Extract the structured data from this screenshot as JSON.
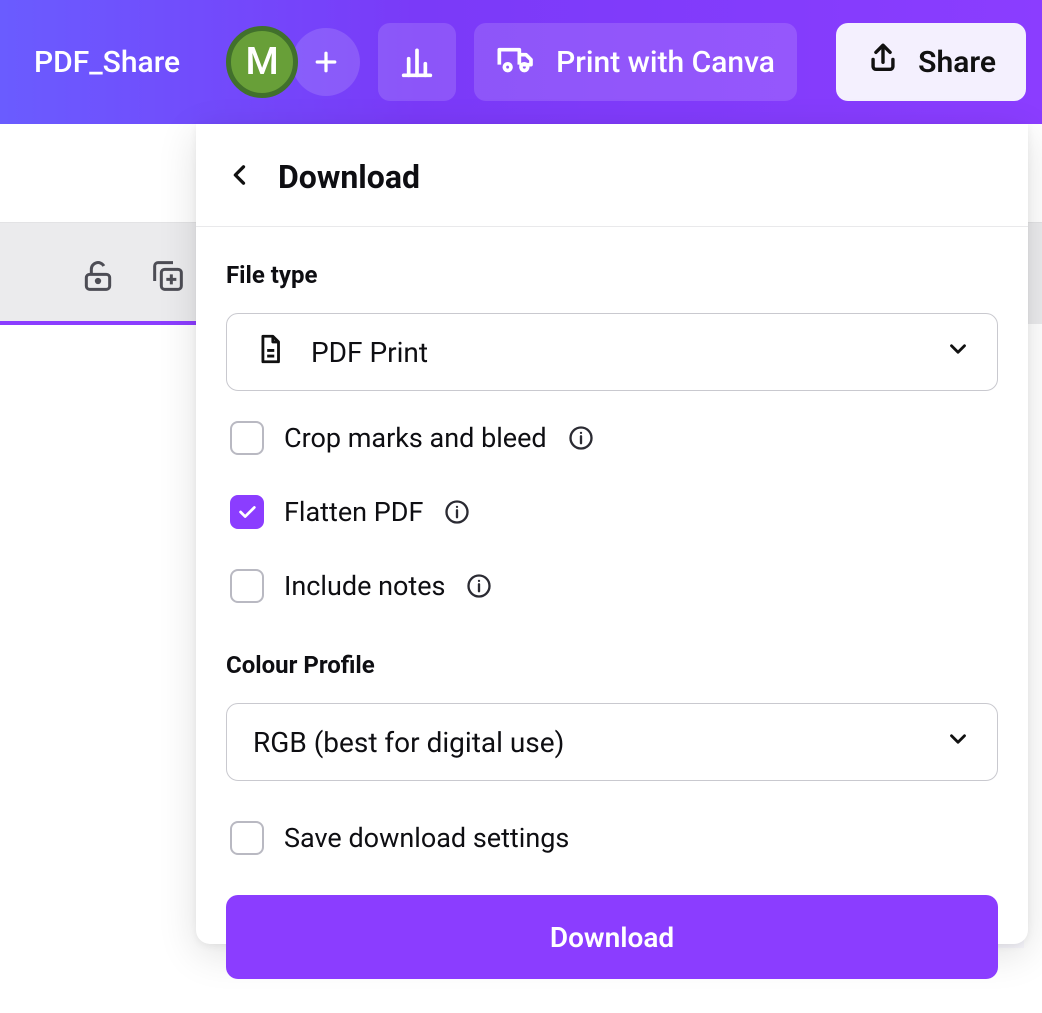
{
  "topbar": {
    "project_title": "PDF_Share",
    "avatar_initial": "M",
    "print_label": "Print with Canva",
    "share_label": "Share"
  },
  "panel": {
    "title": "Download",
    "file_type_label": "File type",
    "file_type_selected": "PDF Print",
    "options": {
      "crop_marks": {
        "label": "Crop marks and bleed",
        "checked": false
      },
      "flatten": {
        "label": "Flatten PDF",
        "checked": true
      },
      "include_notes": {
        "label": "Include notes",
        "checked": false
      }
    },
    "colour_profile_label": "Colour Profile",
    "colour_profile_selected": "RGB (best for digital use)",
    "save_settings": {
      "label": "Save download settings",
      "checked": false
    },
    "download_button": "Download"
  }
}
